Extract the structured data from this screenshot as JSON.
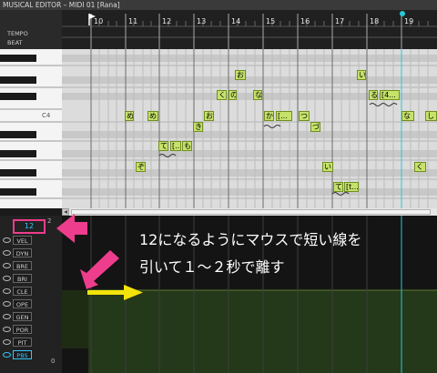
{
  "window": {
    "title": "MUSICAL EDITOR – MIDI 01 [Rana]"
  },
  "ruler": {
    "row_labels": [
      "TEMPO",
      "BEAT"
    ],
    "bars": [
      "10",
      "11",
      "12",
      "13",
      "14",
      "15",
      "16",
      "17",
      "18",
      "19"
    ]
  },
  "piano": {
    "c4_label": "C4"
  },
  "notes": [
    {
      "text": "お"
    },
    {
      "text": "い"
    },
    {
      "text": "く"
    },
    {
      "text": "の"
    },
    {
      "text": "な"
    },
    {
      "text": "る"
    },
    {
      "text": "[4..."
    },
    {
      "text": "め"
    },
    {
      "text": "め"
    },
    {
      "text": "お"
    },
    {
      "text": "か"
    },
    {
      "text": "[..."
    },
    {
      "text": "つ"
    },
    {
      "text": "な"
    },
    {
      "text": "し"
    },
    {
      "text": "き"
    },
    {
      "text": "づ"
    },
    {
      "text": "て"
    },
    {
      "text": "[..."
    },
    {
      "text": "も"
    },
    {
      "text": "ぞ"
    },
    {
      "text": "い"
    },
    {
      "text": "く"
    },
    {
      "text": "て"
    },
    {
      "text": "[t..."
    }
  ],
  "control": {
    "value_box": "12",
    "top_value": "2",
    "bottom_value": "0",
    "params": [
      "VEL",
      "DYN",
      "BRE",
      "BRI",
      "CLE",
      "OPE",
      "GEN",
      "POR",
      "PIT",
      "PBS"
    ]
  },
  "annotation": {
    "line1": "12になるようにマウスで短い線を",
    "line2": "引いて１〜２秒で離す"
  },
  "colors": {
    "note_fill": "#c6e26a",
    "annotation_magenta": "#ee3d8c",
    "arrow_yellow": "#f2e30a",
    "playhead_cyan": "#28c8d8",
    "pbs_fill": "#24381a"
  }
}
